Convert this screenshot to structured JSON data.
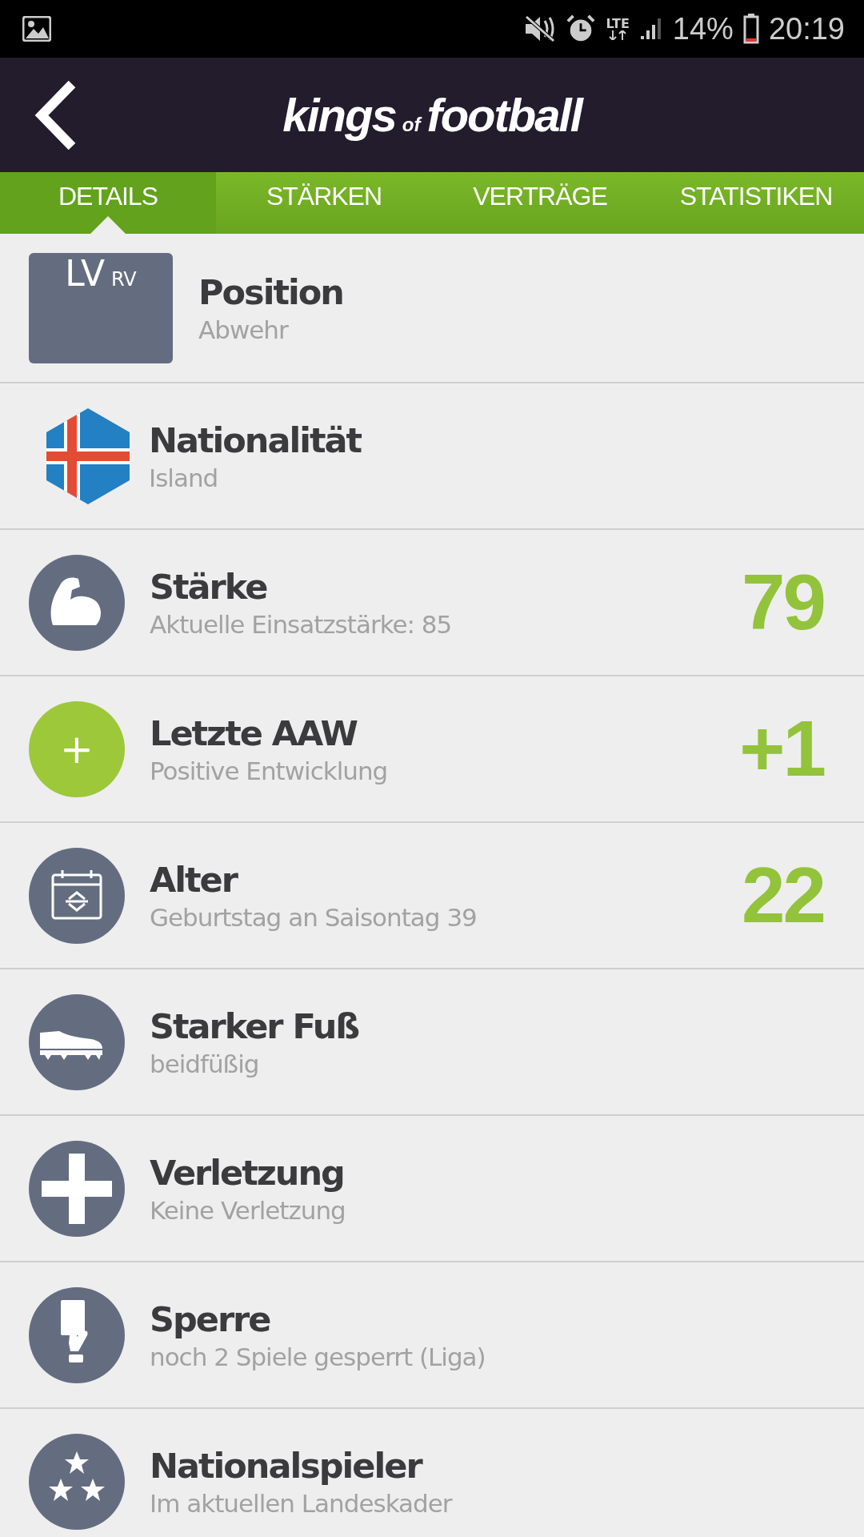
{
  "status_bar": {
    "network": "LTE",
    "battery": "14%",
    "time": "20:19"
  },
  "header": {
    "logo": {
      "first": "kings",
      "middle": "of",
      "last": "football"
    }
  },
  "tabs": [
    {
      "label": "DETAILS",
      "selected": true
    },
    {
      "label": "STÄRKEN",
      "selected": false
    },
    {
      "label": "VERTRÄGE",
      "selected": false
    },
    {
      "label": "STATISTIKEN",
      "selected": false
    }
  ],
  "rows": [
    {
      "kind": "position",
      "badge": [
        "LV",
        "RV"
      ],
      "title": "Position",
      "subtitle": "Abwehr"
    },
    {
      "kind": "flag",
      "title": "Nationalität",
      "subtitle": "Island"
    },
    {
      "kind": "muscle",
      "title": "Stärke",
      "subtitle": "Aktuelle Einsatzstärke: 85",
      "value": "79"
    },
    {
      "kind": "trend",
      "symbol": "+",
      "title": "Letzte AAW",
      "subtitle": "Positive Entwicklung",
      "value": "+1"
    },
    {
      "kind": "calendar",
      "title": "Alter",
      "subtitle": "Geburtstag an Saisontag 39",
      "value": "22"
    },
    {
      "kind": "boot",
      "title": "Starker Fuß",
      "subtitle": "beidfüßig"
    },
    {
      "kind": "injury",
      "title": "Verletzung",
      "subtitle": "Keine Verletzung"
    },
    {
      "kind": "card",
      "title": "Sperre",
      "subtitle": "noch 2 Spiele gesperrt (Liga)"
    },
    {
      "kind": "stars",
      "title": "Nationalspieler",
      "subtitle": "Im aktuellen Landeskader"
    }
  ]
}
